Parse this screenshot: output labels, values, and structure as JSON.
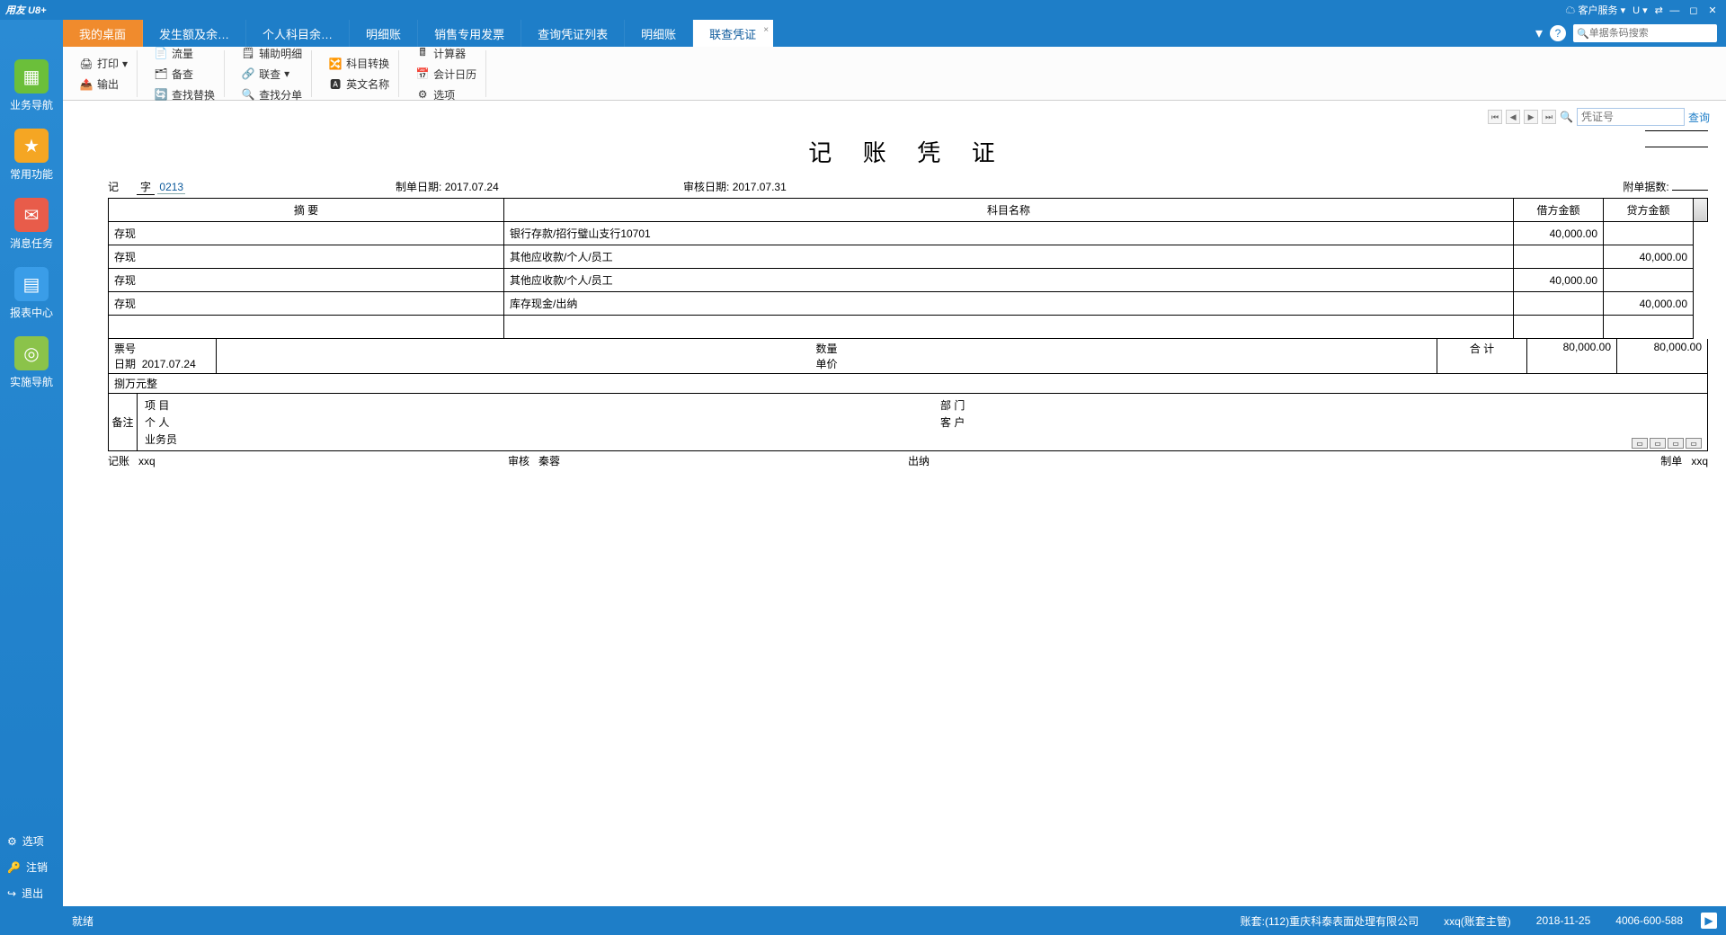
{
  "titlebar": {
    "logo": "用友 U8+",
    "service": "客户服务",
    "u_menu": "U"
  },
  "leftnav": {
    "items": [
      {
        "label": "业务导航"
      },
      {
        "label": "常用功能"
      },
      {
        "label": "消息任务"
      },
      {
        "label": "报表中心"
      },
      {
        "label": "实施导航"
      }
    ],
    "bottom": {
      "options": "选项",
      "logout": "注销",
      "exit": "退出"
    }
  },
  "tabs": [
    {
      "label": "我的桌面"
    },
    {
      "label": "发生额及余…"
    },
    {
      "label": "个人科目余…"
    },
    {
      "label": "明细账"
    },
    {
      "label": "销售专用发票"
    },
    {
      "label": "查询凭证列表"
    },
    {
      "label": "明细账"
    },
    {
      "label": "联查凭证",
      "active": true
    }
  ],
  "barcode_placeholder": "单据条码搜索",
  "ribbon": {
    "print": "打印",
    "output": "输出",
    "flow": "流量",
    "fallback": "备查",
    "findrep": "查找替换",
    "auxdetail": "辅助明细",
    "relquery": "联查",
    "findsplit": "查找分单",
    "subjswitch": "科目转换",
    "enname": "英文名称",
    "calc": "计算器",
    "acctcal": "会计日历",
    "opt": "选项"
  },
  "pager": {
    "placeholder": "凭证号",
    "query": "查询"
  },
  "voucher": {
    "title": "记 账 凭 证",
    "prefix": "记",
    "zi": "字",
    "number": "0213",
    "make_date_label": "制单日期:",
    "make_date": "2017.07.24",
    "audit_date_label": "审核日期:",
    "audit_date": "2017.07.31",
    "attach_label": "附单据数:",
    "cols": {
      "summary": "摘   要",
      "subject": "科目名称",
      "debit": "借方金额",
      "credit": "贷方金额"
    },
    "rows": [
      {
        "summary": "存现",
        "subject": "银行存款/招行璧山支行10701",
        "debit": "40,000.00",
        "credit": ""
      },
      {
        "summary": "存现",
        "subject": "其他应收款/个人/员工",
        "debit": "",
        "credit": "40,000.00"
      },
      {
        "summary": "存现",
        "subject": "其他应收款/个人/员工",
        "debit": "40,000.00",
        "credit": ""
      },
      {
        "summary": "存现",
        "subject": "库存现金/出纳",
        "debit": "",
        "credit": "40,000.00"
      }
    ],
    "bill_no_label": "票号",
    "bill_date_label": "日期",
    "bill_date": "2017.07.24",
    "qty_label": "数量",
    "price_label": "单价",
    "total_label": "合 计",
    "total_debit": "80,000.00",
    "total_credit": "80,000.00",
    "amount_words": "捌万元整",
    "remark_label": "备注",
    "fields": {
      "project": "项 目",
      "dept": "部 门",
      "person": "个 人",
      "customer": "客 户",
      "sales": "业务员"
    },
    "sign": {
      "bookkeep": "记账",
      "bookkeep_v": "xxq",
      "audit": "审核",
      "audit_v": "秦蓉",
      "cashier": "出纳",
      "maker": "制单",
      "maker_v": "xxq"
    }
  },
  "status": {
    "ready": "就绪",
    "account": "账套:(112)重庆科泰表面处理有限公司",
    "user": "xxq(账套主管)",
    "date": "2018-11-25",
    "hotline": "4006-600-588"
  }
}
